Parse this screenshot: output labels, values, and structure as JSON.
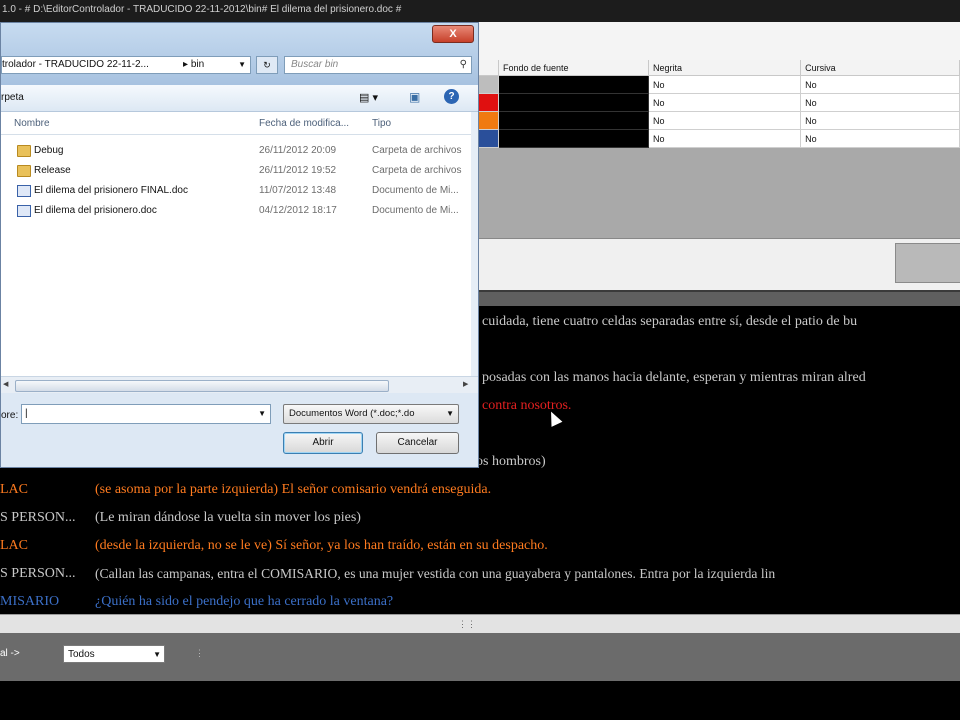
{
  "window": {
    "title": "1.0 - #  D:\\EditorControlador - TRADUCIDO 22-11-2012\\bin# El dilema del prisionero.doc #"
  },
  "grid": {
    "columns": [
      "Fondo de fuente",
      "Negrita",
      "Cursiva"
    ],
    "rows": [
      {
        "swatch": "#bdbdbd",
        "negrita": "No",
        "cursiva": "No"
      },
      {
        "swatch": "#e01010",
        "negrita": "No",
        "cursiva": "No"
      },
      {
        "swatch": "#f07a10",
        "negrita": "No",
        "cursiva": "No"
      },
      {
        "swatch": "#2a4f9a",
        "negrita": "No",
        "cursiva": "No"
      }
    ]
  },
  "script": {
    "lines": [
      {
        "text": "cuidada, tiene cuatro celdas separadas entre sí, desde el patio de bu",
        "color": "white"
      },
      {
        "text": "posadas con las manos hacia delante, esperan y mientras miran alred",
        "color": "white"
      },
      {
        "text": "contra nosotros.",
        "color": "red"
      },
      {
        "text": "os hombros)",
        "color": "white"
      },
      {
        "speaker": "LAC",
        "text": "(se asoma por la parte izquierda) El señor comisario vendrá enseguida.",
        "color": "orange"
      },
      {
        "speaker": "S PERSON...",
        "text": "(Le miran dándose la vuelta sin mover los pies)",
        "color": "white"
      },
      {
        "speaker": "LAC",
        "text": "(desde la izquierda, no se le ve) Sí señor, ya los han traído, están en su despacho.",
        "color": "orange"
      },
      {
        "speaker": "S PERSON...",
        "text": "(Callan las campanas, entra el COMISARIO, es una mujer vestida con una guayabera y pantalones. Entra por la izquierda lin",
        "color": "white"
      },
      {
        "speaker": "MISARIO",
        "text": "¿Quién ha sido el pendejo que ha cerrado la ventana?",
        "color": "blue"
      }
    ]
  },
  "filter": {
    "label": "al ->",
    "selected": "Todos"
  },
  "dialog": {
    "menu_faint": "Nueva carpeta",
    "address": "trolador - TRADUCIDO 22-11-2...",
    "address_sep": "▸",
    "address_folder": "bin",
    "search_placeholder": "Buscar bin",
    "toolbar_label": "rpeta",
    "columns": {
      "name": "Nombre",
      "date": "Fecha de modifica...",
      "type": "Tipo"
    },
    "files": [
      {
        "name": "Debug",
        "date": "26/11/2012 20:09",
        "type": "Carpeta de archivos",
        "kind": "folder"
      },
      {
        "name": "Release",
        "date": "26/11/2012 19:52",
        "type": "Carpeta de archivos",
        "kind": "folder"
      },
      {
        "name": "El dilema del prisionero FINAL.doc",
        "date": "11/07/2012 13:48",
        "type": "Documento de Mi...",
        "kind": "doc"
      },
      {
        "name": "El dilema del prisionero.doc",
        "date": "04/12/2012 18:17",
        "type": "Documento de Mi...",
        "kind": "doc"
      }
    ],
    "filename_label": "ore:",
    "filename_value": "",
    "filetype": "Documentos Word (*.doc;*.do",
    "open_label": "Abrir",
    "cancel_label": "Cancelar",
    "close_glyph": "X"
  }
}
